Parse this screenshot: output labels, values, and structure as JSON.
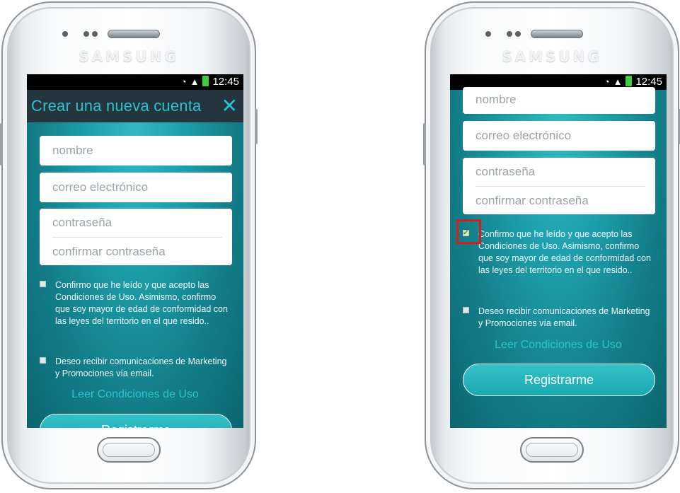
{
  "device": {
    "brand": "SAMSUNG"
  },
  "status": {
    "time": "12:45"
  },
  "screen": {
    "title": "Crear una nueva cuenta",
    "close_icon": "close-icon",
    "fields": {
      "name_placeholder": "nombre",
      "email_placeholder": "correo electrónico",
      "password_placeholder": "contraseña",
      "confirm_placeholder": "confirmar contraseña"
    },
    "checks": {
      "terms": "Confirmo que he leído y que acepto las Condiciones de Uso. Asimismo, confirmo que soy mayor de edad de conformidad con las leyes del territorio en el que resido..",
      "marketing": "Deseo recibir comunicaciones de Marketing y Promociones vía email."
    },
    "terms_link": "Leer Condiciones de Uso",
    "register_button": "Registrarme"
  },
  "left_phone": {
    "terms_checked": false,
    "marketing_checked": false
  },
  "right_phone": {
    "terms_checked": true,
    "marketing_checked": false
  },
  "colors": {
    "accent": "#27c3d0",
    "highlight": "#d91c1c",
    "appbar": "#25353d"
  }
}
